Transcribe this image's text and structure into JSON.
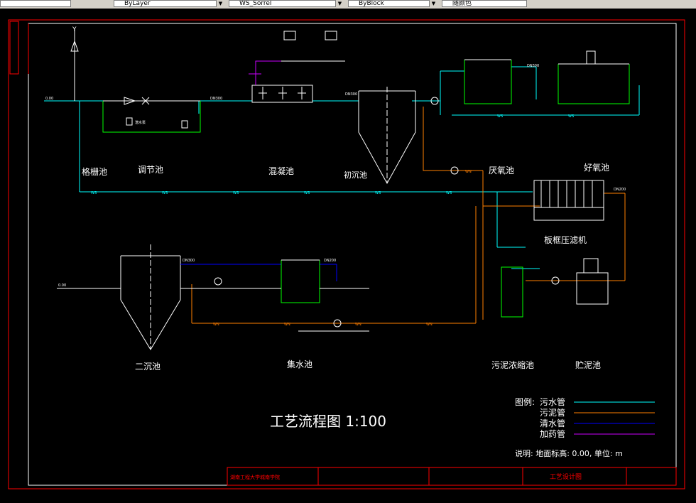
{
  "toolbar": {
    "layer_value": "ByLayer",
    "linetype_value": "WS_Sorrel",
    "lineweight_value": "ByBlock",
    "plotstyle_value": "随颜色"
  },
  "units": {
    "grille": "格栅池",
    "equalization": "调节池",
    "coagulation": "混凝池",
    "primary_clarifier": "初沉池",
    "anoxic": "厌氧池",
    "aerobic": "好氧池",
    "filter_press": "板框压滤机",
    "secondary_clarifier": "二沉池",
    "collection": "集水池",
    "sludge_thickener": "污泥浓缩池",
    "sludge_storage": "贮泥池"
  },
  "labels": {
    "pipe_dn": "DN300",
    "pipe_dn200": "DN200",
    "elevation": "0.00",
    "pump": "潜水泵",
    "line_ws": "WS",
    "line_wn": "WN",
    "drug_y": "Y"
  },
  "main_title": "工艺流程图 1:100",
  "legend": {
    "heading": "图例:",
    "items": [
      {
        "name": "污水管",
        "code": "WS",
        "color": "#00ffff"
      },
      {
        "name": "污泥管",
        "code": "WN",
        "color": "#ff7f00"
      },
      {
        "name": "清水管",
        "code": "=",
        "color": "#0000ff"
      },
      {
        "name": "加药管",
        "code": "Y",
        "color": "#cc00ff"
      }
    ]
  },
  "note": "说明: 地面标高: 0.00, 单位: m",
  "title_block": {
    "school": "湖南工程大学城南学院",
    "drawing_name": "工艺设计图"
  }
}
